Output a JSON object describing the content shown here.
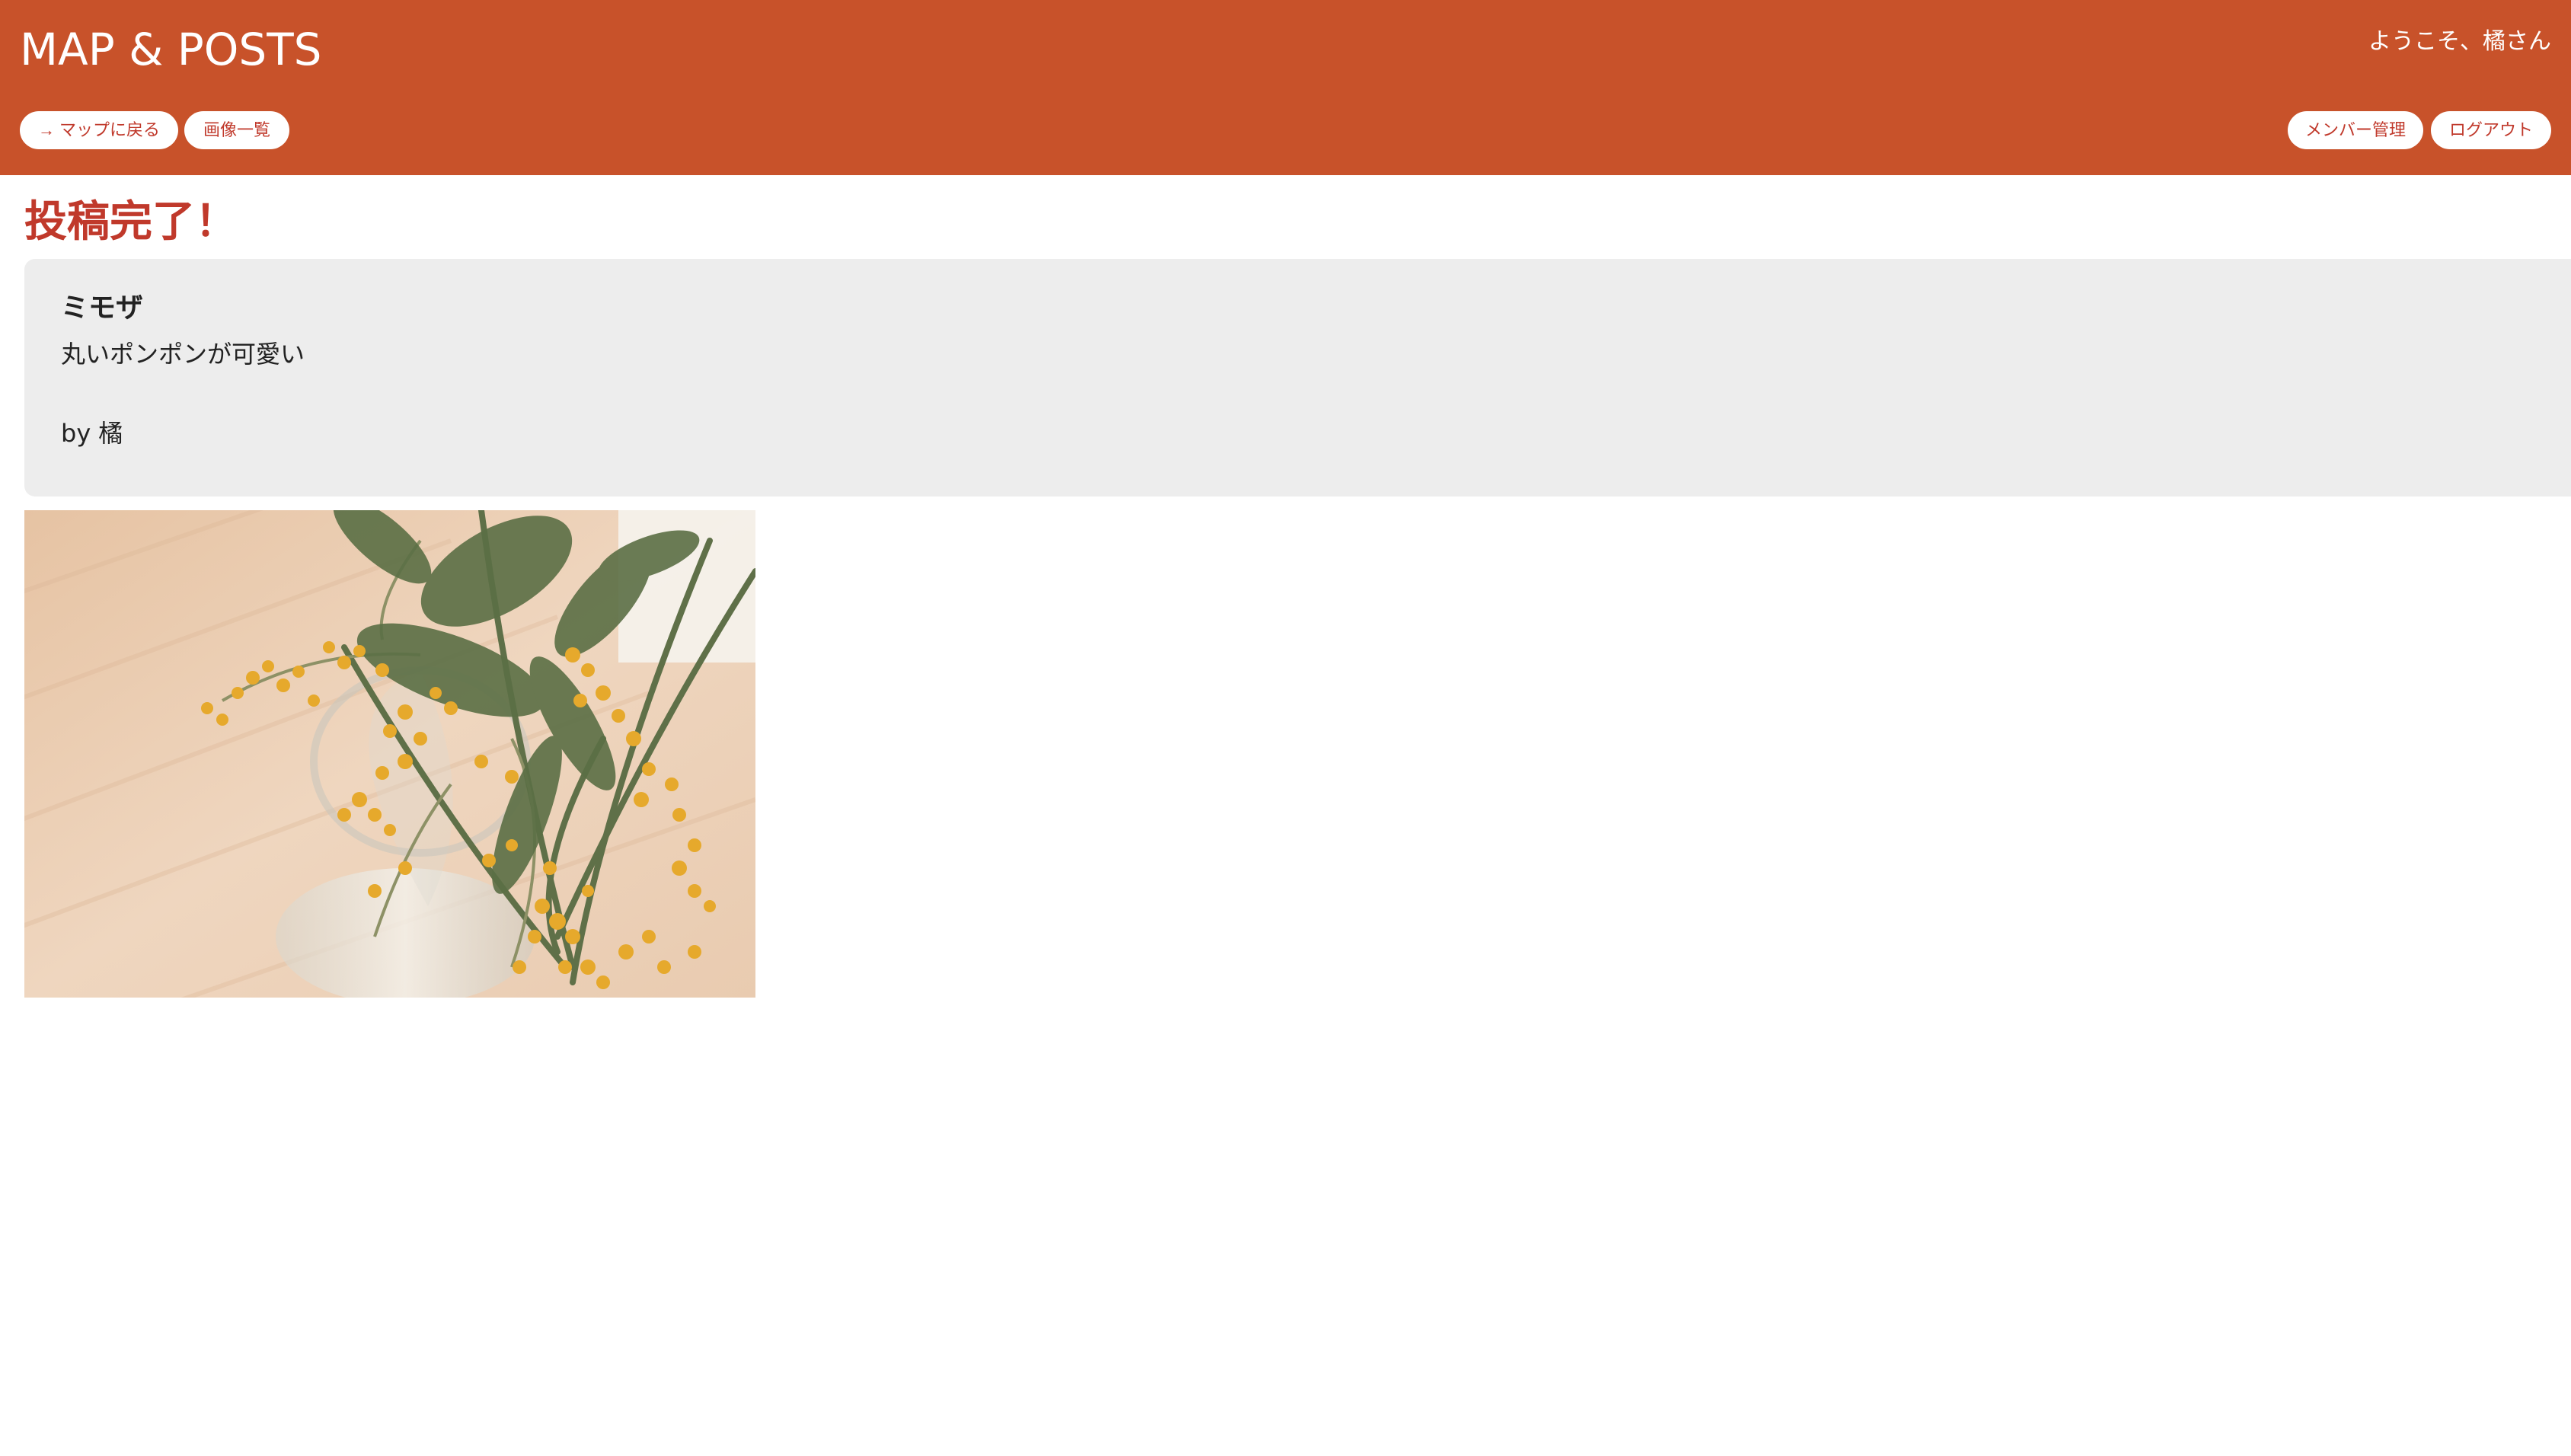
{
  "header": {
    "app_title": "MAP & POSTS",
    "welcome_text": "ようこそ、橘さん",
    "nav": {
      "back_to_map_label": "→ マップに戻る",
      "image_list_label": "画像一覧",
      "member_admin_label": "メンバー管理",
      "logout_label": "ログアウト"
    }
  },
  "main": {
    "heading": "投稿完了！",
    "post": {
      "title": "ミモザ",
      "body": "丸いポンポンが可愛い",
      "author": "by 橘"
    },
    "photo": {
      "icon": "mimosa-photo"
    }
  },
  "colors": {
    "accent": "#c8522a",
    "heading": "#c0392b",
    "card_background": "#ededed"
  }
}
